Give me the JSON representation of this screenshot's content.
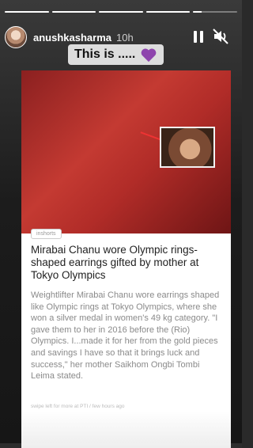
{
  "story": {
    "progress": [
      1,
      1,
      1,
      1,
      0.2
    ],
    "username": "anushkasharma",
    "time_ago": "10h",
    "caption": "This is .....",
    "caption_emoji_icon": "purple-heart-icon",
    "accent_color": "#8e44ad"
  },
  "shared_post": {
    "source_tag": "inshorts",
    "headline": "Mirabai Chanu wore Olympic rings-shaped earrings gifted by mother at Tokyo Olympics",
    "body": "Weightlifter Mirabai Chanu wore earrings shaped like Olympic rings at Tokyo Olympics, where she won a silver medal in women's 49 kg category. \"I gave them to her in 2016 before the (Rio) Olympics. I...made it for her from the gold pieces and savings I have so that it brings luck and success,\" her mother Saikhom Ongbi Tombi Leima stated.",
    "footer": "swipe left for more at PTI / few hours ago"
  }
}
